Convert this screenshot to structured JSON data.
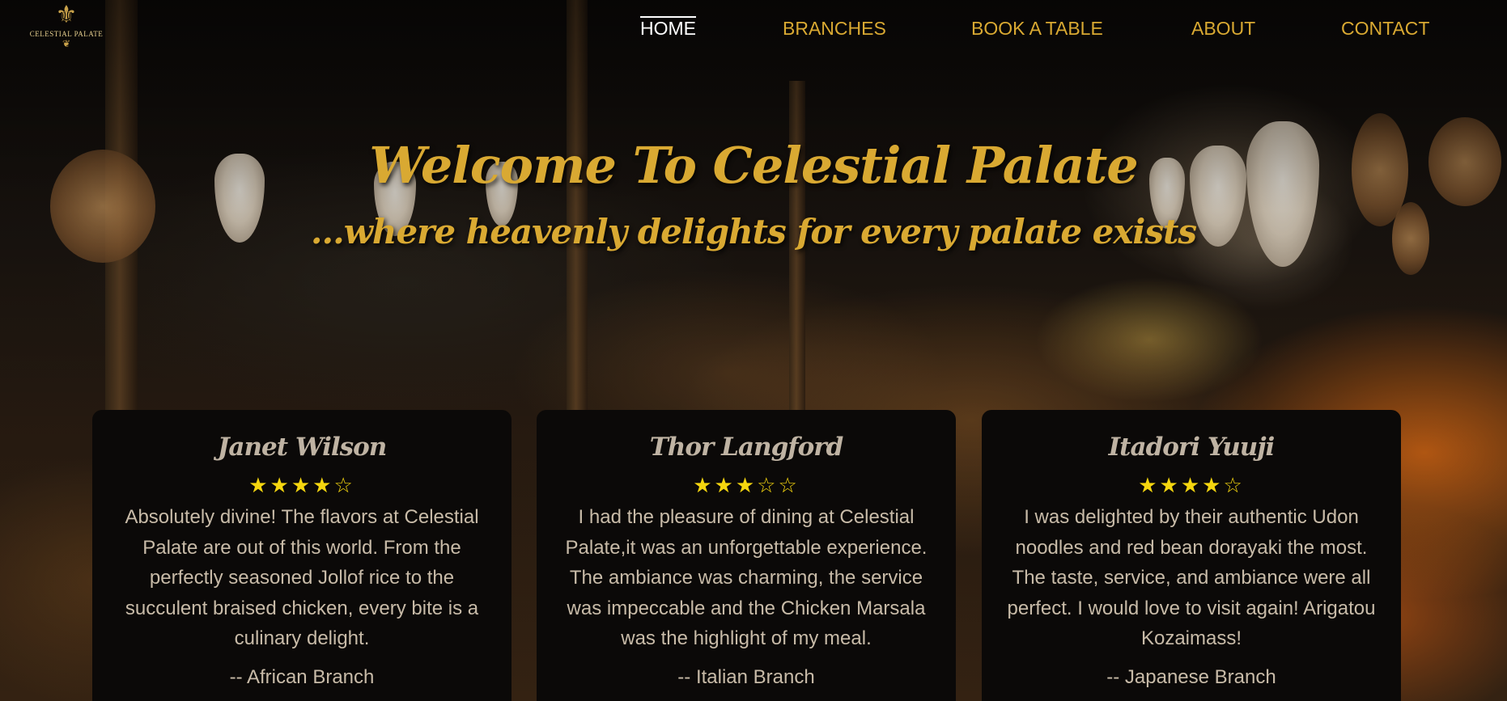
{
  "brand": {
    "logo_text": "CELESTIAL PALATE",
    "accent_color": "#d9a932",
    "active_color": "#ffffff",
    "star_color": "#f5d60f",
    "card_bg": "#0b0908"
  },
  "nav": {
    "items": [
      {
        "label": "HOME",
        "active": true
      },
      {
        "label": "BRANCHES",
        "active": false
      },
      {
        "label": "BOOK A TABLE",
        "active": false
      },
      {
        "label": "ABOUT",
        "active": false
      },
      {
        "label": "CONTACT",
        "active": false
      }
    ]
  },
  "hero": {
    "title": "Welcome To Celestial Palate",
    "subtitle": "...where heavenly delights for every palate exists"
  },
  "reviews": [
    {
      "name": "Janet Wilson",
      "rating": 4,
      "stars": "★★★★☆",
      "text": "Absolutely divine! The flavors at Celestial Palate are out of this world. From the perfectly seasoned Jollof rice to the succulent braised chicken, every bite is a culinary delight.",
      "branch": "-- African Branch"
    },
    {
      "name": "Thor Langford",
      "rating": 3,
      "stars": "★★★☆☆",
      "text": "I had the pleasure of dining at Celestial Palate,it was an unforgettable experience. The ambiance was charming, the service was impeccable and the Chicken Marsala was the highlight of my meal.",
      "branch": "-- Italian Branch"
    },
    {
      "name": "Itadori Yuuji",
      "rating": 4,
      "stars": "★★★★☆",
      "text": "I was delighted by their authentic Udon noodles and red bean dorayaki the most. The taste, service, and ambiance were all perfect. I would love to visit again! Arigatou Kozaimass!",
      "branch": "-- Japanese Branch"
    }
  ]
}
